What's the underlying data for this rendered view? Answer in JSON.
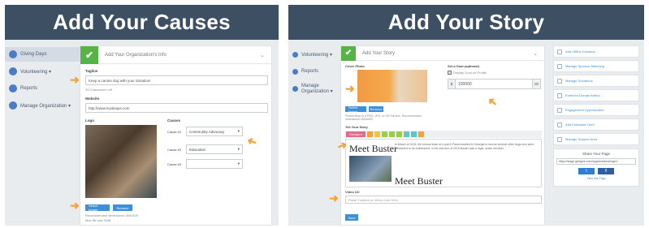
{
  "left": {
    "banner": "Add Your Causes",
    "sidebar": [
      {
        "label": "Giving Days",
        "active": true
      },
      {
        "label": "Volunteering ▾",
        "active": false
      },
      {
        "label": "Reports",
        "active": false
      },
      {
        "label": "Manage Organization ▾",
        "active": false
      }
    ],
    "card_title": "Add Your Organization's Info",
    "tagline_label": "Tagline",
    "tagline_value": "Keep a canine dog with your donation!",
    "chars_left": "33 Characters Left",
    "website_label": "Website",
    "website_value": "http://www.loyalsaps.com",
    "logo_label": "Logo",
    "causes_label": "Causes",
    "causes": [
      {
        "label": "Cause #1",
        "value": "Community Advocacy"
      },
      {
        "label": "Cause #2",
        "value": "Education"
      },
      {
        "label": "Cause #3",
        "value": ""
      }
    ],
    "select_image": "Select Image",
    "remove": "Remove",
    "recommended": "Recommended dimensions 300x300",
    "max_size": "Max file size 5MB"
  },
  "right": {
    "banner": "Add Your Story",
    "sidebar": [
      {
        "label": "Volunteering ▾"
      },
      {
        "label": "Reports"
      },
      {
        "label": "Manage Organization ▾"
      }
    ],
    "card_title": "Add Your Story",
    "cover_photo_label": "Cover Photo",
    "goal_label": "Set a Goal (optional)",
    "goal_checkbox": "Display Goal on Profile",
    "goal_currency": "$",
    "goal_value": "100000",
    "goal_suffix": "00",
    "select_image": "Select Image",
    "remove": "Remove",
    "photo_note": "Please keep to a PNG, JPG, or GIF file size. Recommended dimensions 1600x900",
    "story_label": "Tell Your Story",
    "editor_format": "Formats ▾",
    "story_heading": "Meet Buster",
    "story_heading2": "Meet Buster",
    "story_text": "In March of 2015, the rescue team at Loyal K-Paws traveled to Georgia to rescue several other dogs who were scheduled to be euthanized. In the summer of 2016 Buster was a loyal, active member...",
    "video_label": "Video Url",
    "video_placeholder": "Paste Youtube or Vimeo Link Here",
    "save": "Save",
    "right_items": [
      "Add Offline Donation",
      "Manage Sponsor Matching",
      "Manage Donations",
      "Embed a Donate Button",
      "Engagement Opportunities",
      "Add Endorsed Fund",
      "Manage Support Area"
    ],
    "share_title": "Share Your Page",
    "share_url": "https://stage.givegive.com/organizations/luger-i",
    "view_page": "View this Page"
  },
  "colors": {
    "banner": "#3c4f63",
    "accent_blue": "#3d8fd8",
    "check_green": "#55b544",
    "arrow_orange": "#f2a33a"
  },
  "icons": [
    "check-icon",
    "chevron-down-icon",
    "arrow-right-icon",
    "twitter-icon",
    "facebook-icon"
  ]
}
